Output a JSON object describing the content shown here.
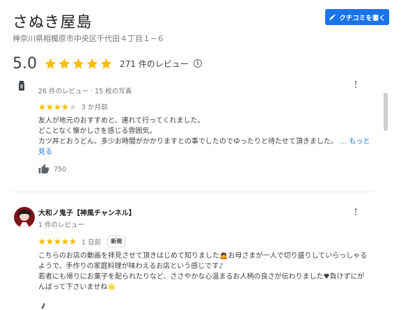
{
  "place": {
    "name": "さぬき屋島",
    "address": "神奈川県相模原市中央区千代田４丁目１−６",
    "rating": "5.0",
    "review_count": "271 件のレビュー",
    "write_review_label": "クチコミを書く",
    "star_color": "#fbbc04",
    "accent_color": "#1a73e8"
  },
  "reviews": [
    {
      "meta": "26 件のレビュー · 15 枚の写真",
      "stars": 4,
      "date": "3 か月前",
      "text": "友人が地元のおすすめと、連れて行ってくれました。\nどことなく懐かしさを感じる雰囲気。\nカツ丼とおうどん、多少お時間がかかりますとの事でしたのでゆったりと待たせて頂きました。",
      "more_label": "… もっと見る",
      "likes": "750"
    },
    {
      "name": "大和ノ鬼子【神風チャンネル】",
      "meta": "1 件のレビュー",
      "stars": 5,
      "date": "1 日前",
      "badge": "新規",
      "text": "こちらのお店の動画を拝見させて頂きはじめて知りました🙇お母さまが一人で切り盛りしていらっしゃるようで、手作りの家庭料理が味わえるお店という感じです♪\n若者にも帰りにお菓子を配られたりなど、ささやかな心温まるお人柄の良さが伝わりました♥負けずにがんばって下さいませね🌟"
    }
  ]
}
